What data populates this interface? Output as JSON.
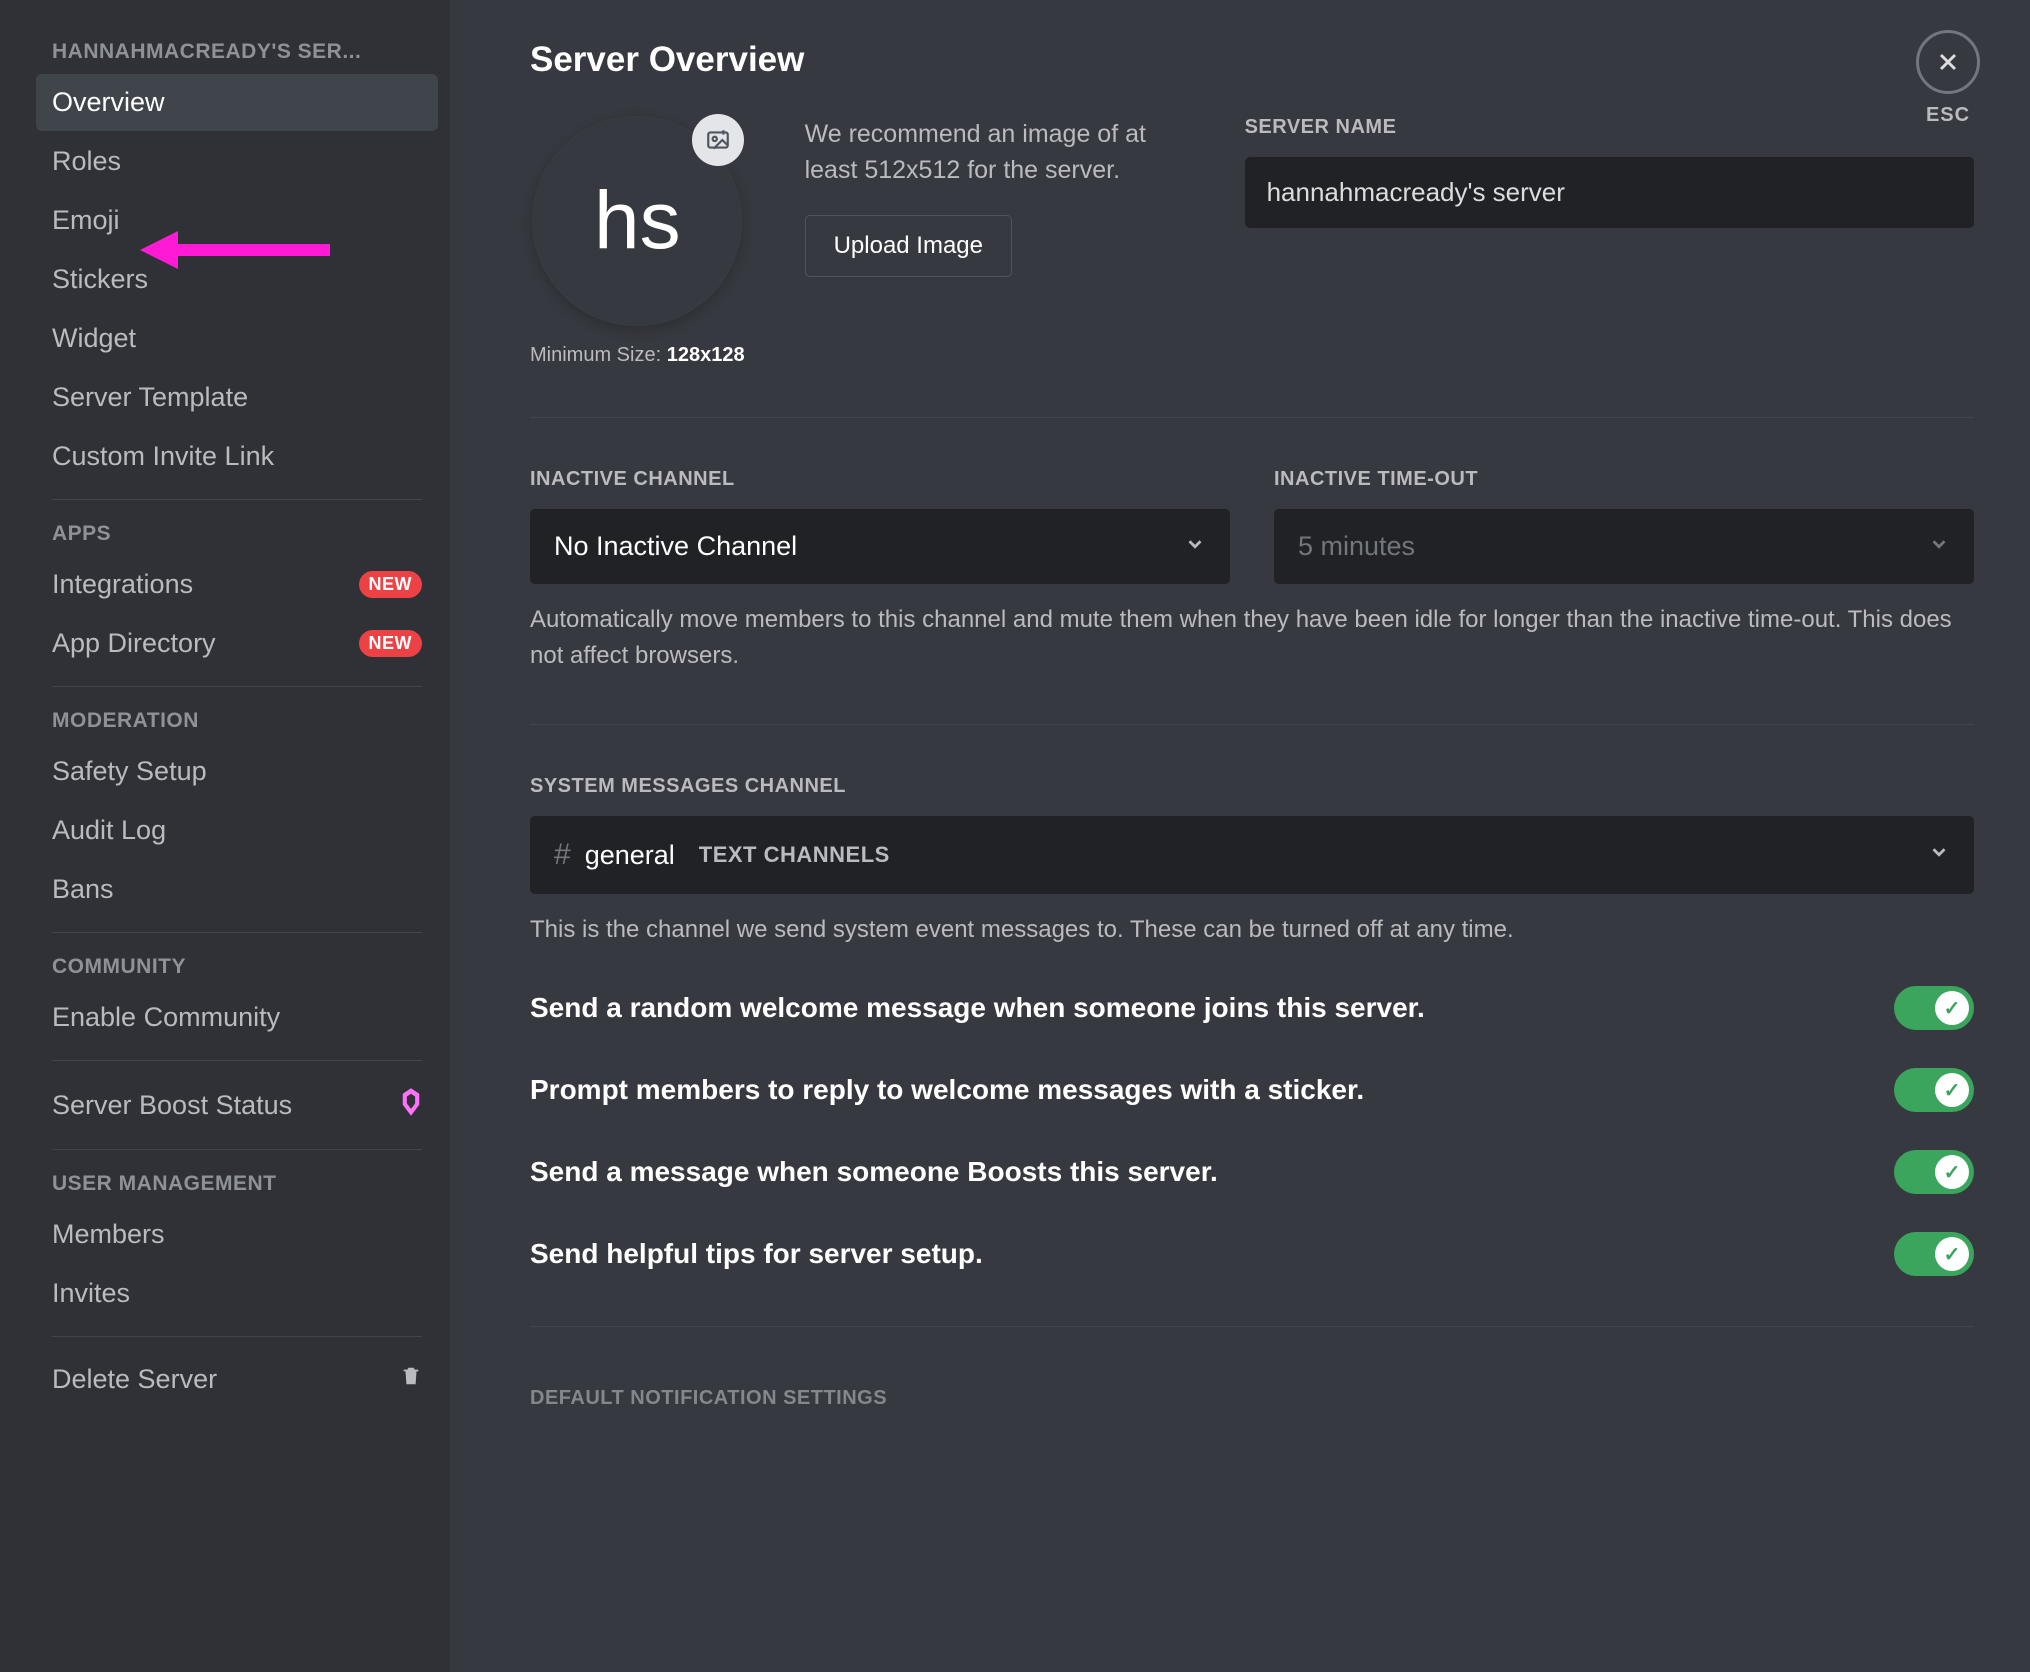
{
  "sidebar": {
    "header": "HANNAHMACREADY'S SER...",
    "sections": [
      {
        "items": [
          {
            "label": "Overview",
            "selected": true
          },
          {
            "label": "Roles"
          },
          {
            "label": "Emoji"
          },
          {
            "label": "Stickers"
          },
          {
            "label": "Widget"
          },
          {
            "label": "Server Template"
          },
          {
            "label": "Custom Invite Link"
          }
        ]
      },
      {
        "title": "APPS",
        "items": [
          {
            "label": "Integrations",
            "badge": "NEW"
          },
          {
            "label": "App Directory",
            "badge": "NEW"
          }
        ]
      },
      {
        "title": "MODERATION",
        "items": [
          {
            "label": "Safety Setup"
          },
          {
            "label": "Audit Log"
          },
          {
            "label": "Bans"
          }
        ]
      },
      {
        "title": "COMMUNITY",
        "items": [
          {
            "label": "Enable Community"
          }
        ]
      },
      {
        "items": [
          {
            "label": "Server Boost Status",
            "boost": true
          }
        ]
      },
      {
        "title": "USER MANAGEMENT",
        "items": [
          {
            "label": "Members"
          },
          {
            "label": "Invites"
          }
        ]
      },
      {
        "items": [
          {
            "label": "Delete Server",
            "trash": true
          }
        ]
      }
    ]
  },
  "page": {
    "title": "Server Overview",
    "close_esc": "ESC",
    "avatar_initials": "hs",
    "min_size_prefix": "Minimum Size: ",
    "min_size_value": "128x128",
    "reco_text": "We recommend an image of at least 512x512 for the server.",
    "upload_button": "Upload Image",
    "server_name_label": "SERVER NAME",
    "server_name_value": "hannahmacready's server",
    "inactive_channel_label": "INACTIVE CHANNEL",
    "inactive_channel_value": "No Inactive Channel",
    "inactive_timeout_label": "INACTIVE TIME-OUT",
    "inactive_timeout_value": "5 minutes",
    "inactive_help": "Automatically move members to this channel and mute them when they have been idle for longer than the inactive time-out. This does not affect browsers.",
    "sys_channel_label": "SYSTEM MESSAGES CHANNEL",
    "sys_channel_name": "general",
    "sys_channel_category": "TEXT CHANNELS",
    "sys_channel_help": "This is the channel we send system event messages to. These can be turned off at any time.",
    "toggles": [
      "Send a random welcome message when someone joins this server.",
      "Prompt members to reply to welcome messages with a sticker.",
      "Send a message when someone Boosts this server.",
      "Send helpful tips for server setup."
    ],
    "cutoff_section": "DEFAULT NOTIFICATION SETTINGS"
  }
}
